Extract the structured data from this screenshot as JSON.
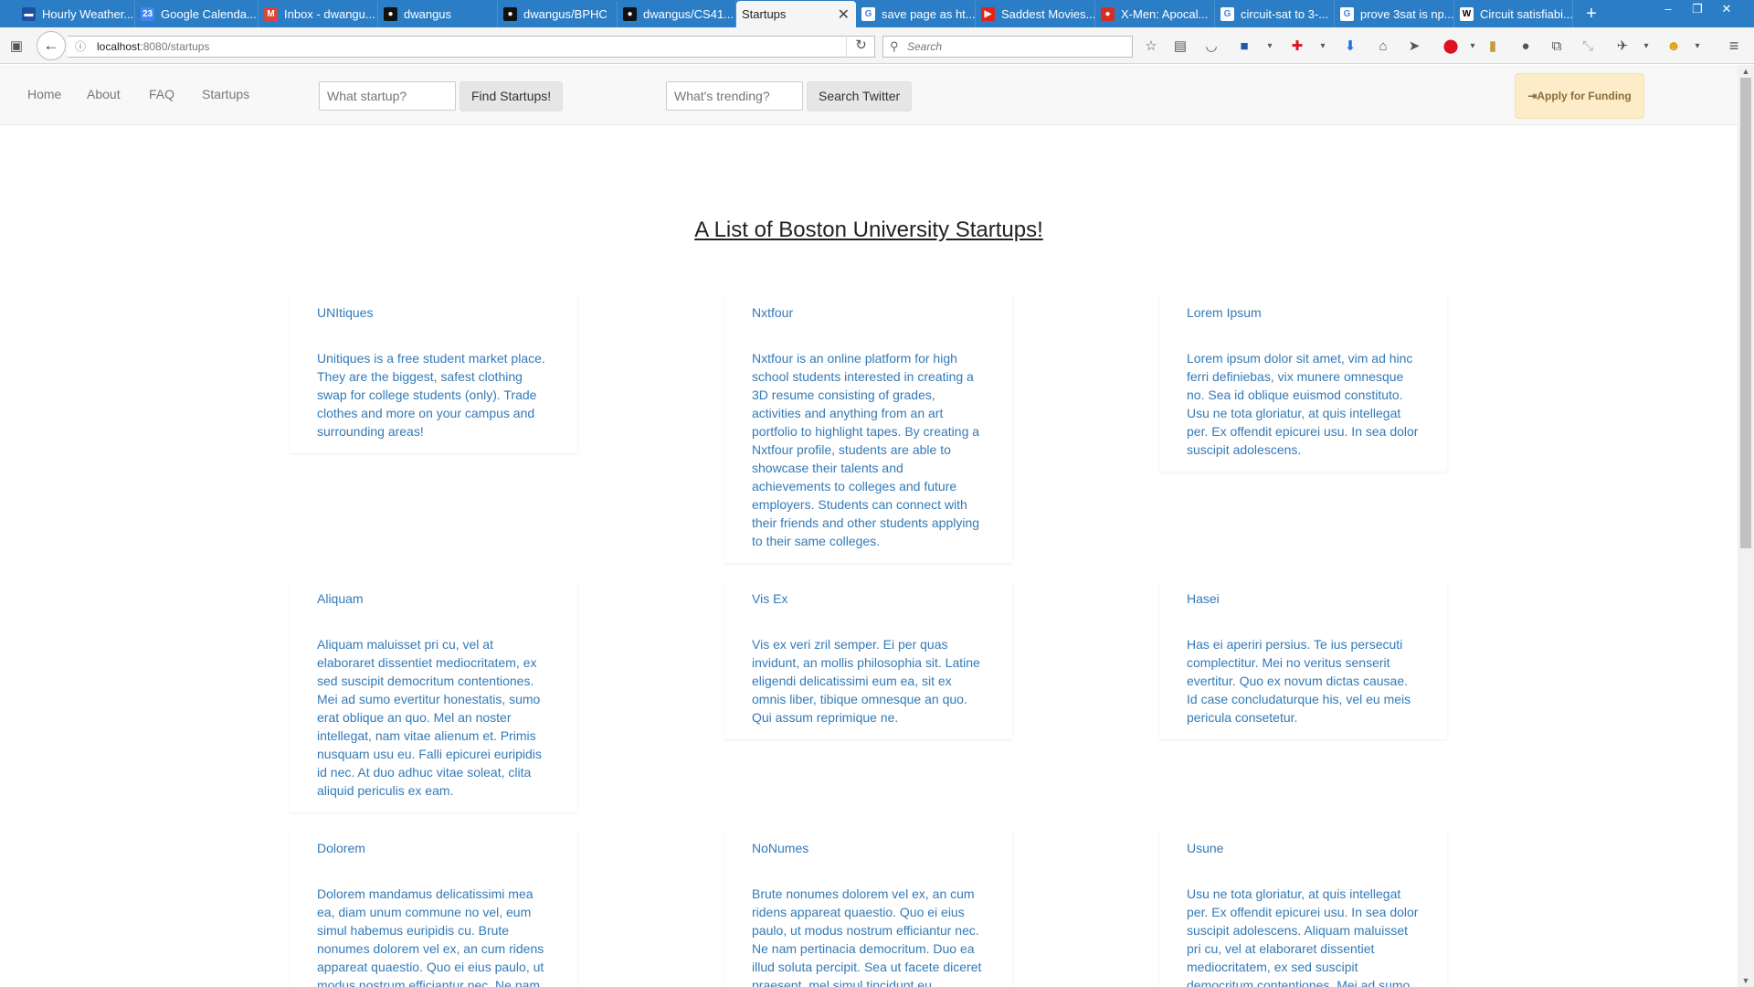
{
  "browser": {
    "tabs": [
      {
        "title": "Hourly Weather...",
        "icon": "weather-icon",
        "color": "#1f4fa3",
        "glyph": "▬"
      },
      {
        "title": "Google Calenda...",
        "icon": "calendar-icon",
        "color": "#4285f4",
        "glyph": "23"
      },
      {
        "title": "Inbox - dwangu...",
        "icon": "gmail-icon",
        "color": "#db4437",
        "glyph": "M"
      },
      {
        "title": "dwangus",
        "icon": "github-icon",
        "color": "#111111",
        "glyph": "●"
      },
      {
        "title": "dwangus/BPHC",
        "icon": "github-icon",
        "color": "#111111",
        "glyph": "●"
      },
      {
        "title": "dwangus/CS41...",
        "icon": "github-icon",
        "color": "#111111",
        "glyph": "●"
      },
      {
        "title": "Startups",
        "icon": "page-icon",
        "color": "#f5f5f5",
        "glyph": ""
      },
      {
        "title": "save page as ht...",
        "icon": "google-icon",
        "color": "#ffffff",
        "glyph": "G"
      },
      {
        "title": "Saddest Movies...",
        "icon": "youtube-icon",
        "color": "#e62117",
        "glyph": "▶"
      },
      {
        "title": "X-Men: Apocal...",
        "icon": "tomato-icon",
        "color": "#d62e1f",
        "glyph": "●"
      },
      {
        "title": "circuit-sat to 3-...",
        "icon": "google-icon",
        "color": "#ffffff",
        "glyph": "G"
      },
      {
        "title": "prove 3sat is np...",
        "icon": "google-icon",
        "color": "#ffffff",
        "glyph": "G"
      },
      {
        "title": "Circuit satisfiabi...",
        "icon": "wikipedia-icon",
        "color": "#ffffff",
        "glyph": "W"
      }
    ],
    "new_tab": "+",
    "url_host": "localhost",
    "url_path": ":8080/startups",
    "search_placeholder": "Search"
  },
  "site_nav": {
    "links": [
      "Home",
      "About",
      "FAQ",
      "Startups"
    ],
    "startup_search_placeholder": "What startup?",
    "find_button": "Find Startups!",
    "trend_search_placeholder": "What's trending?",
    "twitter_button": "Search Twitter",
    "funding_button": "Apply for Funding"
  },
  "page_title": "A List of Boston University Startups!",
  "startups": [
    {
      "name": "UNItiques",
      "desc": "Unitiques is a free student market place. They are the biggest, safest clothing swap for college students (only). Trade clothes and more on your campus and surrounding areas!"
    },
    {
      "name": "Nxtfour",
      "desc": "Nxtfour is an online platform for high school students interested in creating a 3D resume consisting of grades, activities and anything from an art portfolio to highlight tapes. By creating a Nxtfour profile, students are able to showcase their talents and achievements to colleges and future employers. Students can connect with their friends and other students applying to their same colleges."
    },
    {
      "name": "Lorem Ipsum",
      "desc": "Lorem ipsum dolor sit amet, vim ad hinc ferri definiebas, vix munere omnesque no. Sea id oblique euismod constituto. Usu ne tota gloriatur, at quis intellegat per. Ex offendit epicurei usu. In sea dolor suscipit adolescens."
    },
    {
      "name": "Aliquam",
      "desc": "Aliquam maluisset pri cu, vel at elaboraret dissentiet mediocritatem, ex sed suscipit democritum contentiones. Mei ad sumo evertitur honestatis, sumo erat oblique an quo. Mel an noster intellegat, nam vitae alienum et. Primis nusquam usu eu. Falli epicurei euripidis id nec. At duo adhuc vitae soleat, clita aliquid periculis ex eam."
    },
    {
      "name": "Vis Ex",
      "desc": "Vis ex veri zril semper. Ei per quas invidunt, an mollis philosophia sit. Latine eligendi delicatissimi eum ea, sit ex omnis liber, tibique omnesque an quo. Qui assum reprimique ne."
    },
    {
      "name": "Hasei",
      "desc": "Has ei aperiri persius. Te ius persecuti complectitur. Mei no veritus senserit evertitur. Quo ex novum dictas causae. Id case concludaturque his, vel eu meis pericula consetetur."
    },
    {
      "name": "Dolorem",
      "desc": "Dolorem mandamus delicatissimi mea ea, diam unum commune no vel, eum simul habemus euripidis cu. Brute nonumes dolorem vel ex, an cum ridens appareat quaestio. Quo ei eius paulo, ut modus nostrum efficiantur nec. Ne nam"
    },
    {
      "name": "NoNumes",
      "desc": "Brute nonumes dolorem vel ex, an cum ridens appareat quaestio. Quo ei eius paulo, ut modus nostrum efficiantur nec. Ne nam pertinacia democritum. Duo ea illud soluta percipit. Sea ut facete diceret praesent, mel simul tincidunt eu."
    },
    {
      "name": "Usune",
      "desc": "Usu ne tota gloriatur, at quis intellegat per. Ex offendit epicurei usu. In sea dolor suscipit adolescens. Aliquam maluisset pri cu, vel at elaboraret dissentiet mediocritatem, ex sed suscipit democritum contentiones. Mei ad sumo"
    }
  ]
}
